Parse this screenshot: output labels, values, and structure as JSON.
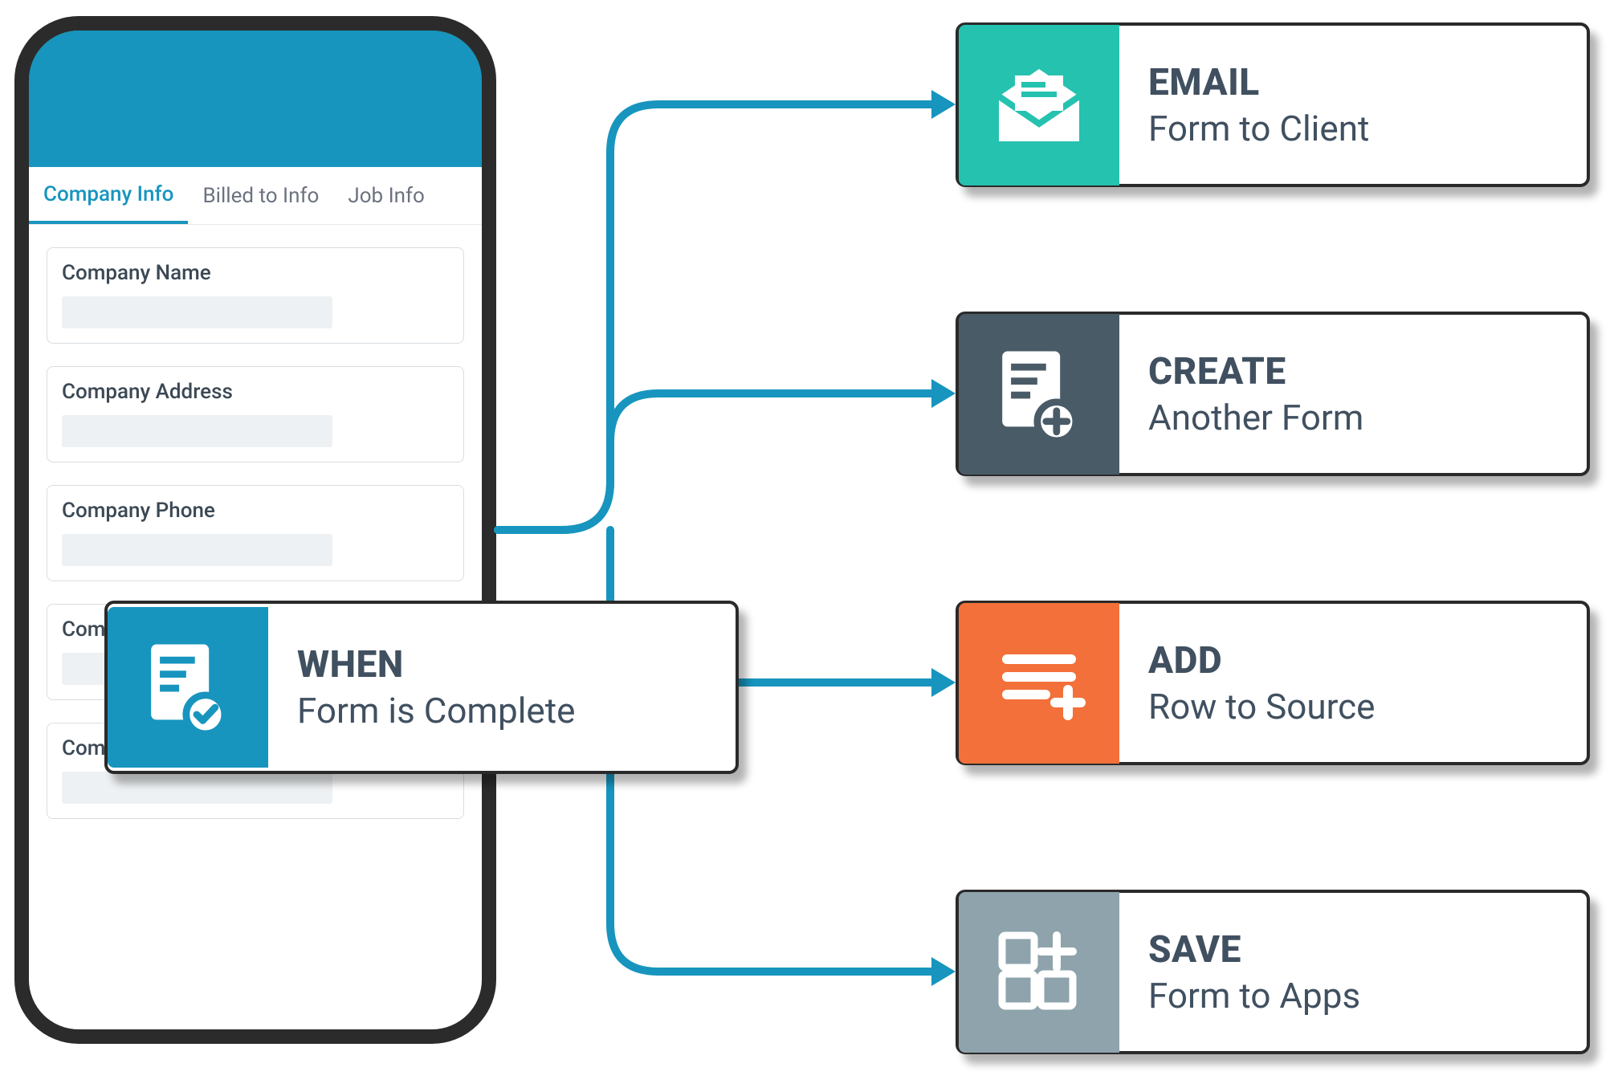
{
  "phone": {
    "tabs": [
      {
        "label": "Company Info",
        "active": true
      },
      {
        "label": "Billed to Info",
        "active": false
      },
      {
        "label": "Job Info",
        "active": false
      }
    ],
    "fields": [
      {
        "label": "Company Name"
      },
      {
        "label": "Company Address"
      },
      {
        "label": "Company Phone"
      },
      {
        "label": "Company Email"
      },
      {
        "label": "Company Email"
      }
    ]
  },
  "trigger": {
    "title": "WHEN",
    "sub": "Form is Complete",
    "icon": "doc-check-icon",
    "color": "#1795be"
  },
  "actions": [
    {
      "title": "EMAIL",
      "sub": "Form to Client",
      "icon": "mail-icon",
      "color": "#25c2b0"
    },
    {
      "title": "CREATE",
      "sub": "Another Form",
      "icon": "doc-plus-icon",
      "color": "#4a5b68"
    },
    {
      "title": "ADD",
      "sub": "Row to Source",
      "icon": "rows-plus-icon",
      "color": "#f3703a"
    },
    {
      "title": "SAVE",
      "sub": "Form to Apps",
      "icon": "grid-plus-icon",
      "color": "#8ea3ac"
    }
  ]
}
